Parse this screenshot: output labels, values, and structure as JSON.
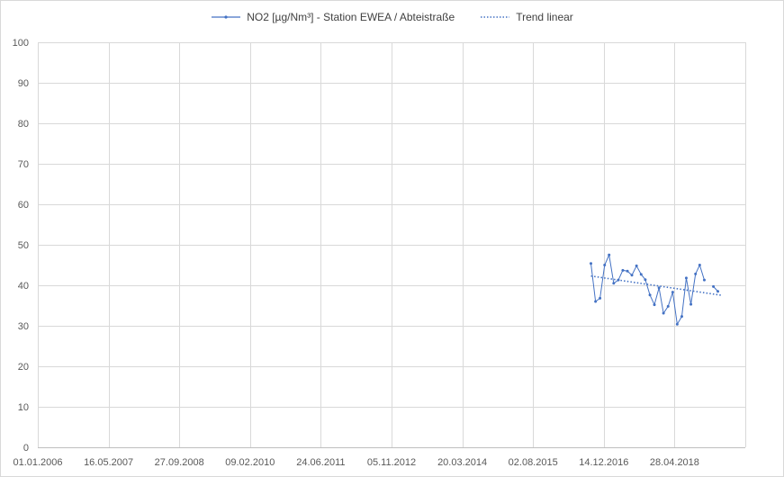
{
  "chart_data": {
    "type": "line",
    "title": "",
    "xlabel": "",
    "ylabel": "",
    "ylim": [
      0,
      100
    ],
    "y_ticks": [
      0,
      10,
      20,
      30,
      40,
      50,
      60,
      70,
      80,
      90,
      100
    ],
    "x_tick_labels": [
      "01.01.2006",
      "16.05.2007",
      "27.09.2008",
      "09.02.2010",
      "24.06.2011",
      "05.11.2012",
      "20.03.2014",
      "02.08.2015",
      "14.12.2016",
      "28.04.2018"
    ],
    "xlim": [
      "2006-01-01",
      "2019-01-01"
    ],
    "grid": true,
    "legend_position": "top",
    "series": [
      {
        "name": "NO2 [µg/Nm³] - Station EWEA / Abteistraße",
        "color": "#4472c4",
        "x": [
          "2016-03-01",
          "2016-04-01",
          "2016-05-01",
          "2016-06-01",
          "2016-07-01",
          "2016-08-01",
          "2016-09-01",
          "2016-10-01",
          "2016-11-01",
          "2016-12-01",
          "2017-01-01",
          "2017-02-01",
          "2017-03-01",
          "2017-04-01",
          "2017-05-01",
          "2017-06-01",
          "2017-07-01",
          "2017-08-01",
          "2017-09-01",
          "2017-10-01",
          "2017-11-01",
          "2017-12-01",
          "2018-01-01",
          "2018-02-01",
          "2018-03-01",
          "2018-04-01",
          "2018-05-01",
          "2018-06-01",
          "2018-07-01",
          "2018-08-01",
          "2018-09-01"
        ],
        "y": [
          45.4,
          36,
          36.8,
          45,
          47.5,
          40.5,
          41.3,
          43.7,
          43.5,
          42.5,
          44.8,
          42.7,
          41.4,
          37.6,
          35.2,
          39.4,
          33.1,
          34.8,
          38.3,
          30.4,
          32.3,
          41.8,
          35.3,
          42.8,
          45.0,
          41.3,
          null,
          39.7,
          38.5,
          null,
          null
        ]
      },
      {
        "name": "Trend linear",
        "color": "#4472c4",
        "style": "dotted",
        "x": [
          "2016-03-01",
          "2018-08-01"
        ],
        "y": [
          42.3,
          37.5
        ]
      }
    ]
  }
}
